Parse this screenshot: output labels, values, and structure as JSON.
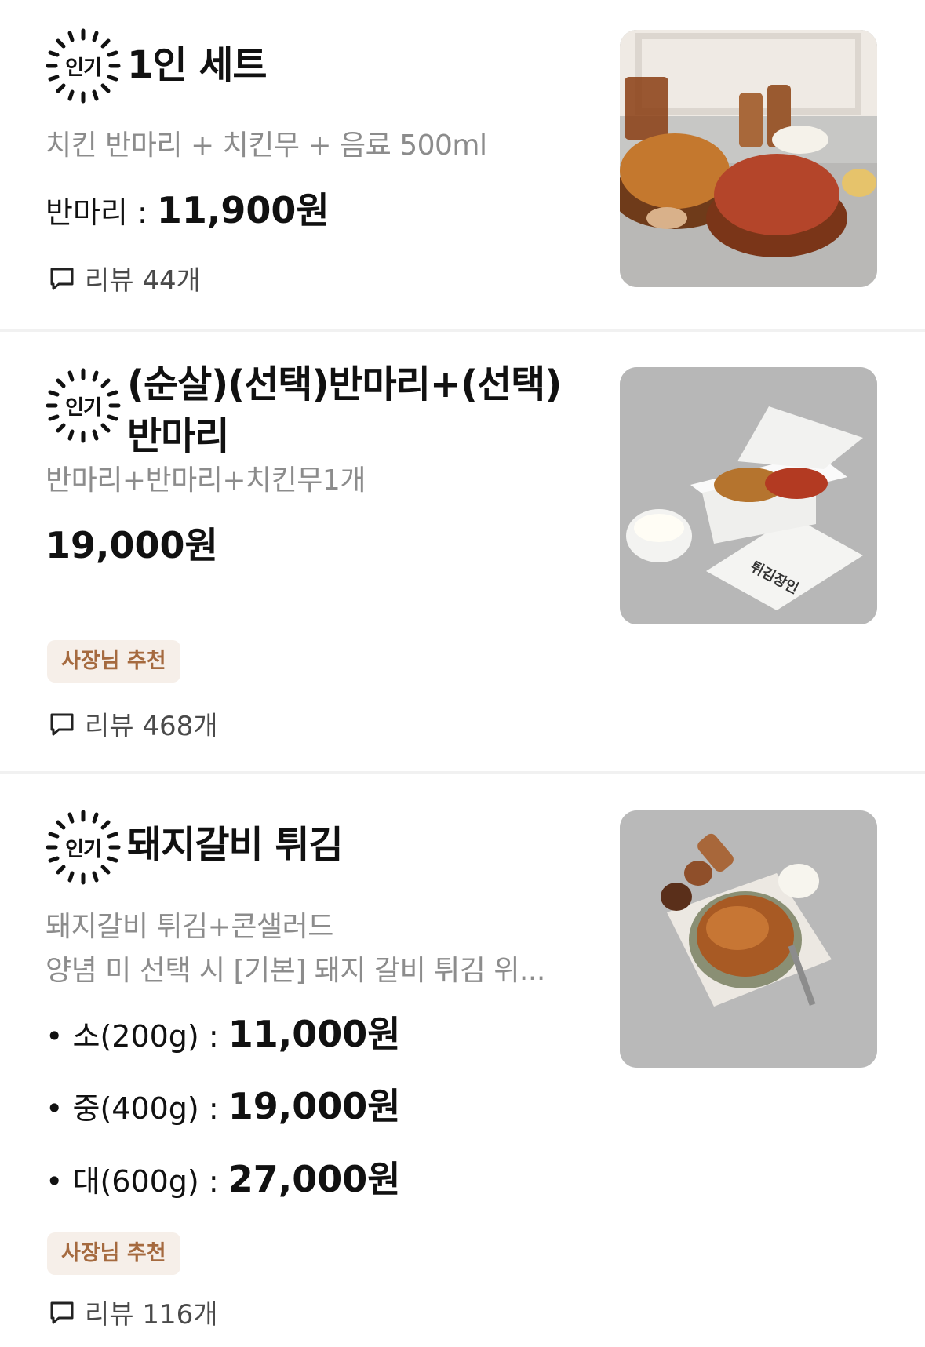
{
  "items": [
    {
      "badge": "인기",
      "title": "1인 세트",
      "desc": "치킨 반마리 + 치킨무 + 음료 500ml",
      "price_label": "반마리 : ",
      "price": "11,900원",
      "review": "리뷰 44개",
      "image_icon": "fried-chicken-set-photo"
    },
    {
      "badge": "인기",
      "title_line1": "(순살)(선택)반마리+(선택)",
      "title_line2": "반마리",
      "desc": "반마리+반마리+치킨무1개",
      "price": "19,000원",
      "tag": "사장님 추천",
      "review": "리뷰 468개",
      "image_icon": "chicken-box-photo",
      "box_text": "튀김장인"
    },
    {
      "badge": "인기",
      "title": "돼지갈비 튀김",
      "desc_line1": "돼지갈비 튀김+콘샐러드",
      "desc_line2": "양념 미 선택 시 [기본] 돼지 갈비 튀김 위...",
      "options": [
        {
          "label": "• 소(200g) : ",
          "price": "11,000원"
        },
        {
          "label": "• 중(400g) : ",
          "price": "19,000원"
        },
        {
          "label": "• 대(600g) : ",
          "price": "27,000원"
        }
      ],
      "tag": "사장님 추천",
      "review": "리뷰 116개",
      "image_icon": "pork-rib-fritter-photo"
    }
  ],
  "colors": {
    "tag_bg": "#f6efe9",
    "tag_text": "#a56a3f",
    "desc_text": "#8c8c8c"
  }
}
